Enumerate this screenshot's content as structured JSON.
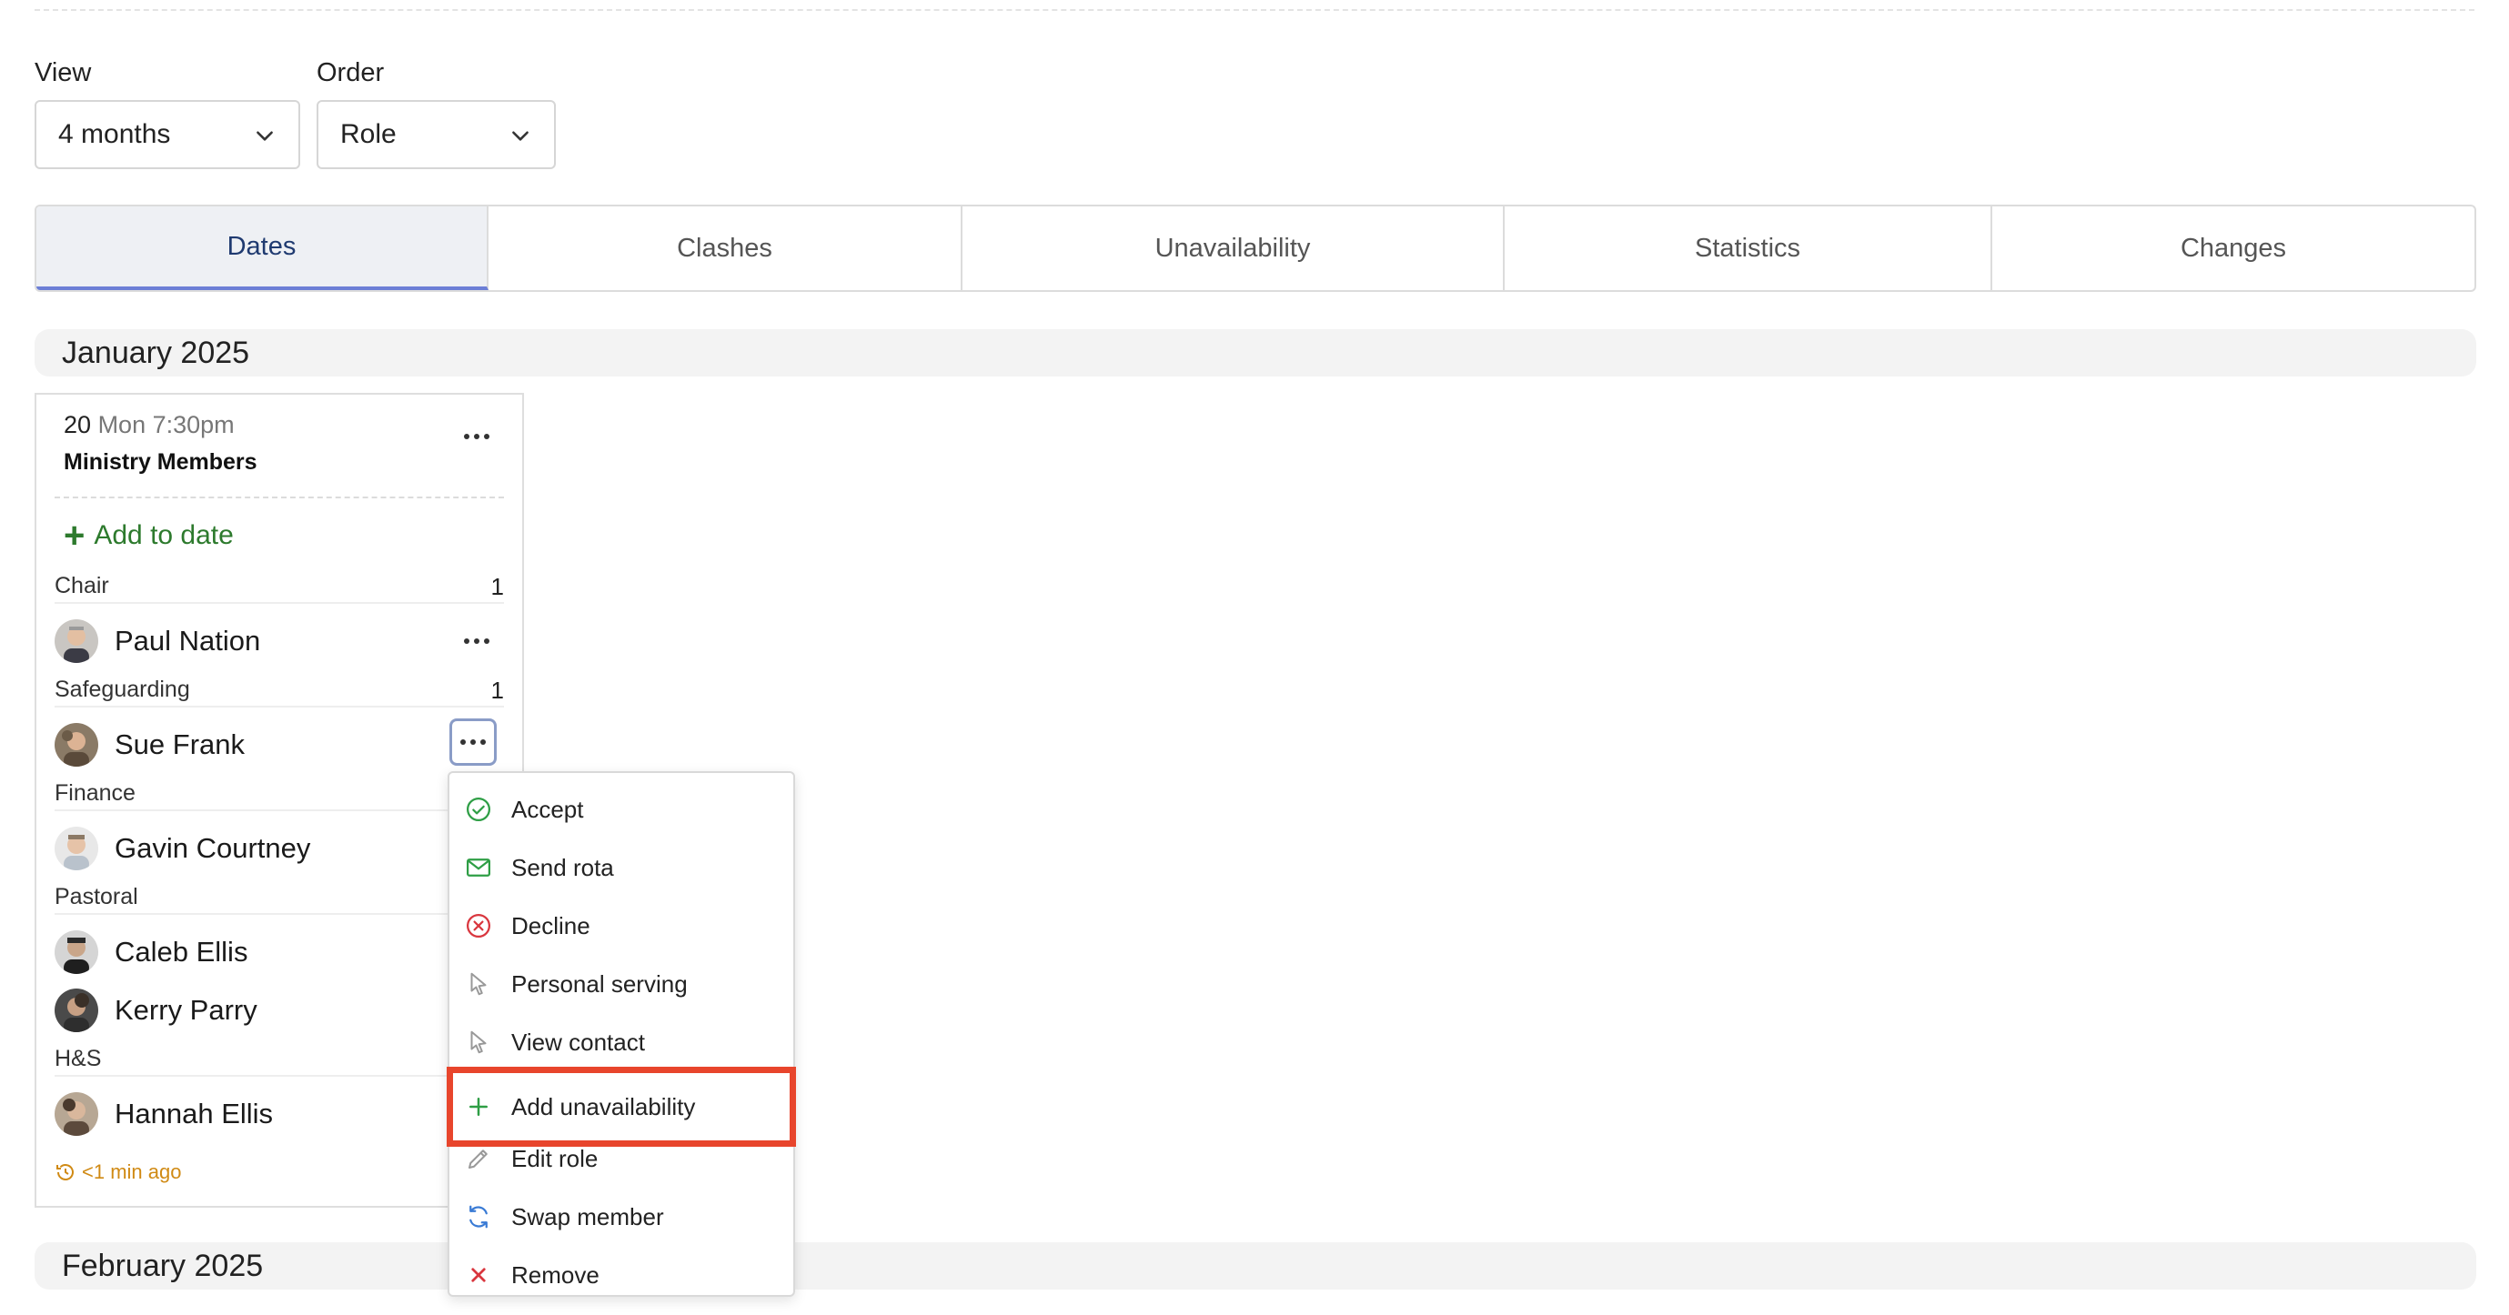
{
  "filters": {
    "view_label": "View",
    "view_value": "4 months",
    "order_label": "Order",
    "order_value": "Role"
  },
  "tabs": [
    {
      "label": "Dates",
      "active": true
    },
    {
      "label": "Clashes",
      "active": false
    },
    {
      "label": "Unavailability",
      "active": false
    },
    {
      "label": "Statistics",
      "active": false
    },
    {
      "label": "Changes",
      "active": false
    }
  ],
  "months": [
    "January 2025",
    "February 2025"
  ],
  "card": {
    "day": "20",
    "day_rest": "Mon 7:30pm",
    "title": "Ministry Members",
    "add_to_date": "Add to date",
    "roles": [
      {
        "name": "Chair",
        "count": "1",
        "members": [
          "Paul Nation"
        ]
      },
      {
        "name": "Safeguarding",
        "count": "1",
        "members": [
          "Sue Frank"
        ]
      },
      {
        "name": "Finance",
        "count": "",
        "members": [
          "Gavin Courtney"
        ]
      },
      {
        "name": "Pastoral",
        "count": "",
        "members": [
          "Caleb Ellis",
          "Kerry Parry"
        ]
      },
      {
        "name": "H&S",
        "count": "",
        "members": [
          "Hannah Ellis"
        ]
      }
    ],
    "updated": "<1 min ago"
  },
  "menu": {
    "items": [
      {
        "label": "Accept",
        "icon": "check-circle-icon",
        "color": "#2e9e45"
      },
      {
        "label": "Send rota",
        "icon": "envelope-icon",
        "color": "#2e9e45"
      },
      {
        "label": "Decline",
        "icon": "x-circle-icon",
        "color": "#d9363e"
      },
      {
        "label": "Personal serving",
        "icon": "pointer-icon",
        "color": "#999999"
      },
      {
        "label": "View contact",
        "icon": "pointer-icon",
        "color": "#999999"
      },
      {
        "label": "Add unavailability",
        "icon": "plus-icon",
        "color": "#2e9e45",
        "highlighted": true
      },
      {
        "label": "Edit role",
        "icon": "pencil-icon",
        "color": "#999999"
      },
      {
        "label": "Swap member",
        "icon": "refresh-icon",
        "color": "#3a7bd5"
      },
      {
        "label": "Remove",
        "icon": "x-icon",
        "color": "#d9363e"
      }
    ]
  },
  "colors": {
    "accent": "#6c7fd6",
    "success": "#2d7a2d",
    "highlight": "#e8452c",
    "timestamp": "#d08a14"
  }
}
